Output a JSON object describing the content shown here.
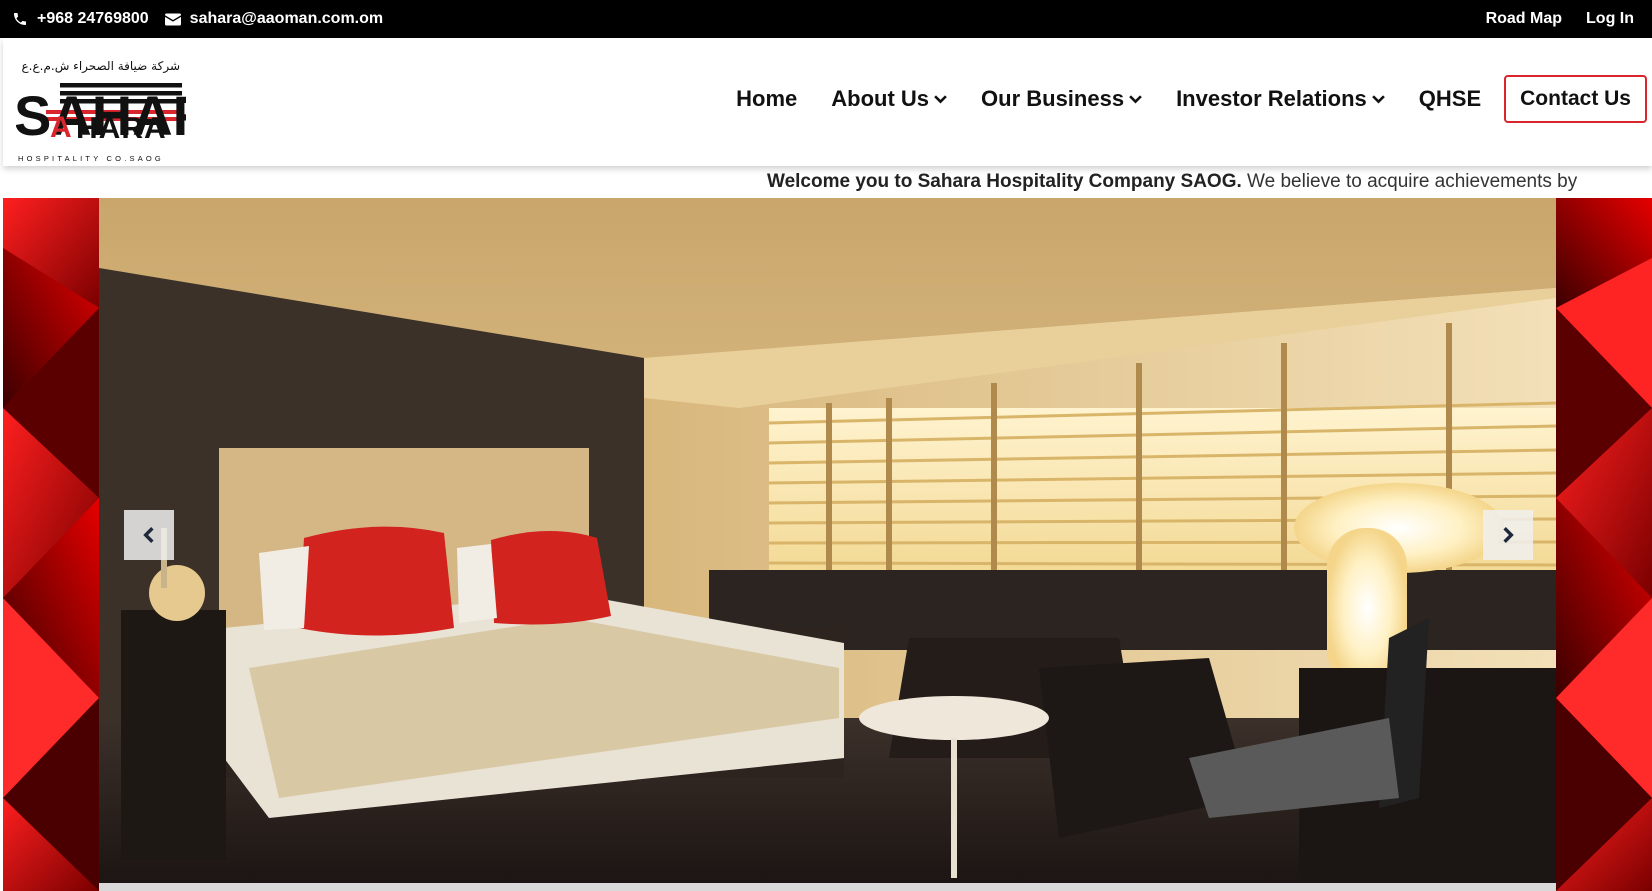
{
  "topbar": {
    "phone": "+968 24769800",
    "email": "sahara@aaoman.com.om",
    "phone_icon": "phone-icon",
    "email_icon": "envelope-icon",
    "links": [
      "Road Map",
      "Log In"
    ]
  },
  "logo": {
    "arabic_name": "شركة ضيافة الصحراء ش.م.ع.ع",
    "wordmark": "SAHARA",
    "tagline": "HOSPITALITY CO.SAOG"
  },
  "nav": {
    "home": "Home",
    "about": "About Us",
    "business": "Our Business",
    "investor": "Investor Relations",
    "qhse": "QHSE",
    "contact": "Contact Us",
    "dropdown_icon": "chevron-down-icon"
  },
  "marquee": {
    "bold": "Welcome you to Sahara Hospitality Company SAOG.",
    "rest": " We believe to acquire achievements by"
  },
  "hero": {
    "prev_icon": "chevron-left-icon",
    "next_icon": "chevron-right-icon"
  },
  "colors": {
    "brand_red": "#d8262c",
    "topbar_bg": "#000000",
    "nav_text": "#111111"
  }
}
